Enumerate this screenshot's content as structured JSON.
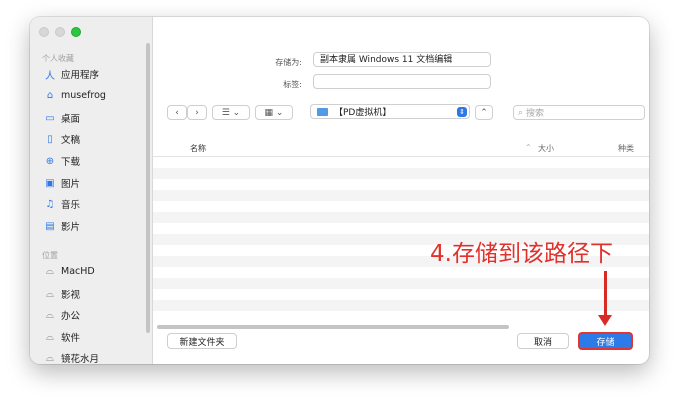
{
  "sidebar": {
    "section_personal": "个人收藏",
    "favorites": [
      {
        "label": "应用程序",
        "icon": "apps-icon"
      },
      {
        "label": "musefrog",
        "icon": "home-icon"
      },
      {
        "label": "桌面",
        "icon": "desktop-icon"
      },
      {
        "label": "文稿",
        "icon": "document-icon"
      },
      {
        "label": "下载",
        "icon": "download-icon"
      },
      {
        "label": "图片",
        "icon": "pictures-icon"
      },
      {
        "label": "音乐",
        "icon": "music-icon"
      },
      {
        "label": "影片",
        "icon": "movies-icon"
      }
    ],
    "section_locations": "位置",
    "locations": [
      {
        "label": "MacHD",
        "icon": "disk-icon"
      },
      {
        "label": "影视",
        "icon": "disk-icon"
      },
      {
        "label": "办公",
        "icon": "disk-icon"
      },
      {
        "label": "软件",
        "icon": "disk-icon"
      },
      {
        "label": "镜花水月",
        "icon": "disk-icon"
      }
    ]
  },
  "form": {
    "save_as_label": "存储为:",
    "save_as_value": "副本隶属 Windows 11 文档编辑",
    "tags_label": "标签:"
  },
  "toolbar": {
    "back": "‹",
    "forward": "›",
    "list_view": "☰ ⌄",
    "grid_view": "▦ ⌄",
    "location": "【PD虚拟机】",
    "expand": "⌃",
    "search_placeholder": "搜索"
  },
  "columns": {
    "name": "名称",
    "sort": "⌃",
    "size": "大小",
    "kind": "种类"
  },
  "buttons": {
    "new_folder": "新建文件夹",
    "cancel": "取消",
    "save": "存储"
  },
  "annotation": "4.存储到该路径下",
  "colors": {
    "accent": "#2d7be8",
    "annotation": "#e2302b"
  }
}
